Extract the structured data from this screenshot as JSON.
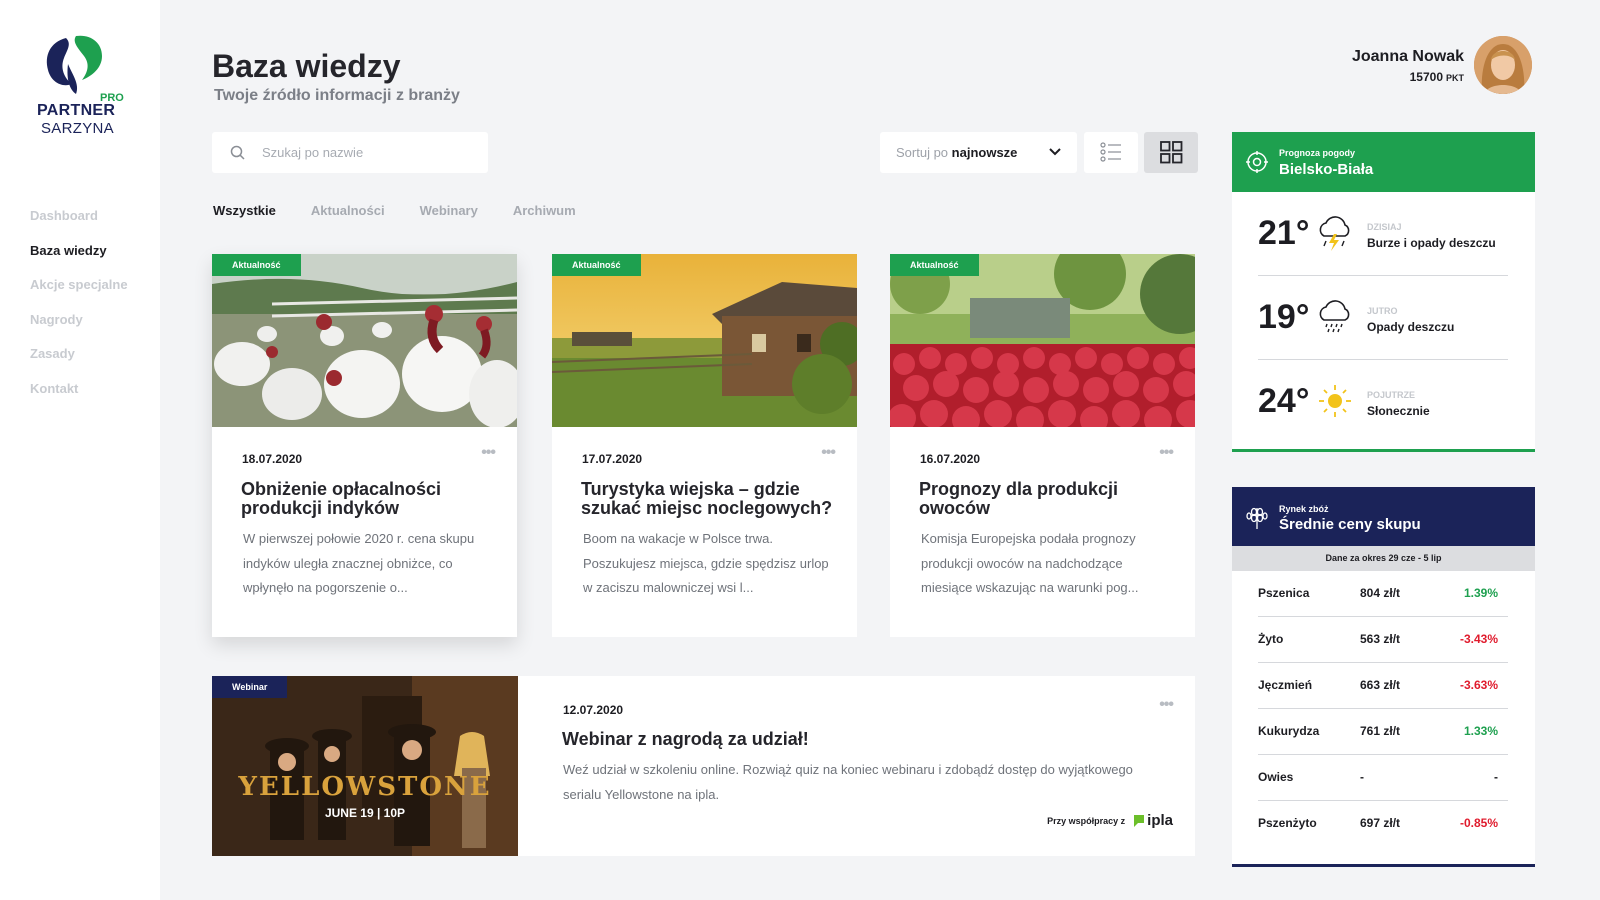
{
  "brand": {
    "pro": "PRO",
    "name_line1": "PARTNER",
    "name_line2": "SARZYNA"
  },
  "nav": [
    {
      "label": "Dashboard",
      "active": false
    },
    {
      "label": "Baza wiedzy",
      "active": true
    },
    {
      "label": "Akcje specjalne",
      "active": false
    },
    {
      "label": "Nagrody",
      "active": false
    },
    {
      "label": "Zasady",
      "active": false
    },
    {
      "label": "Kontakt",
      "active": false
    }
  ],
  "header": {
    "title": "Baza wiedzy",
    "subtitle": "Twoje źródło informacji z branży"
  },
  "user": {
    "name": "Joanna Nowak",
    "points": "15700",
    "points_unit": "PKT"
  },
  "search": {
    "placeholder": "Szukaj po nazwie"
  },
  "sort": {
    "prefix": "Sortuj po",
    "value": "najnowsze"
  },
  "tabs": [
    {
      "label": "Wszystkie",
      "active": true
    },
    {
      "label": "Aktualności",
      "active": false
    },
    {
      "label": "Webinary",
      "active": false
    },
    {
      "label": "Archiwum",
      "active": false
    }
  ],
  "articles": [
    {
      "badge": "Aktualność",
      "date": "18.07.2020",
      "title": "Obniżenie opłacalności produkcji indyków",
      "desc": "W pierwszej połowie 2020 r. cena skupu indyków uległa znacznej obniżce, co wpłynęło na pogorszenie o..."
    },
    {
      "badge": "Aktualność",
      "date": "17.07.2020",
      "title": "Turystyka wiejska – gdzie szukać miejsc noclegowych?",
      "desc": "Boom na wakacje w Polsce trwa. Poszukujesz miejsca, gdzie spędzisz urlop w zaciszu malowniczej wsi l..."
    },
    {
      "badge": "Aktualność",
      "date": "16.07.2020",
      "title": "Prognozy dla produkcji owoców",
      "desc": "Komisja Europejska podała prognozy produkcji owoców na nadchodzące miesiące wskazując na warunki pog..."
    }
  ],
  "webinar": {
    "badge": "Webinar",
    "date": "12.07.2020",
    "title": "Webinar z nagrodą za udział!",
    "desc": "Weź udział w szkoleniu online. Rozwiąż quiz na koniec webinaru i zdobądź dostęp do wyjątkowego serialu Yellowstone na ipla.",
    "partner_label": "Przy współpracy z",
    "partner_name": "ipla",
    "poster_title": "YELLOWSTONE",
    "poster_date": "JUNE 19 | 10P"
  },
  "weather": {
    "label": "Prognoza pogody",
    "city": "Bielsko-Biała",
    "days": [
      {
        "temp": "21°",
        "day": "DZISIAJ",
        "condition": "Burze i opady deszczu",
        "icon": "storm-icon"
      },
      {
        "temp": "19°",
        "day": "JUTRO",
        "condition": "Opady deszczu",
        "icon": "rain-icon"
      },
      {
        "temp": "24°",
        "day": "POJUTRZE",
        "condition": "Słonecznie",
        "icon": "sun-icon"
      }
    ]
  },
  "prices": {
    "label": "Rynek zbóż",
    "title": "Średnie ceny skupu",
    "period": "Dane za okres 29 cze - 5 lip",
    "rows": [
      {
        "name": "Pszenica",
        "price": "804 zł/t",
        "change": "1.39%",
        "trend": "up"
      },
      {
        "name": "Żyto",
        "price": "563 zł/t",
        "change": "-3.43%",
        "trend": "down"
      },
      {
        "name": "Jęczmień",
        "price": "663 zł/t",
        "change": "-3.63%",
        "trend": "down"
      },
      {
        "name": "Kukurydza",
        "price": "761 zł/t",
        "change": "1.33%",
        "trend": "up"
      },
      {
        "name": "Owies",
        "price": "-",
        "change": "-",
        "trend": "neutral"
      },
      {
        "name": "Pszenżyto",
        "price": "697 zł/t",
        "change": "-0.85%",
        "trend": "down"
      }
    ]
  },
  "colors": {
    "green": "#1ea04f",
    "navy": "#1b2359",
    "negative": "#e01b2d"
  }
}
